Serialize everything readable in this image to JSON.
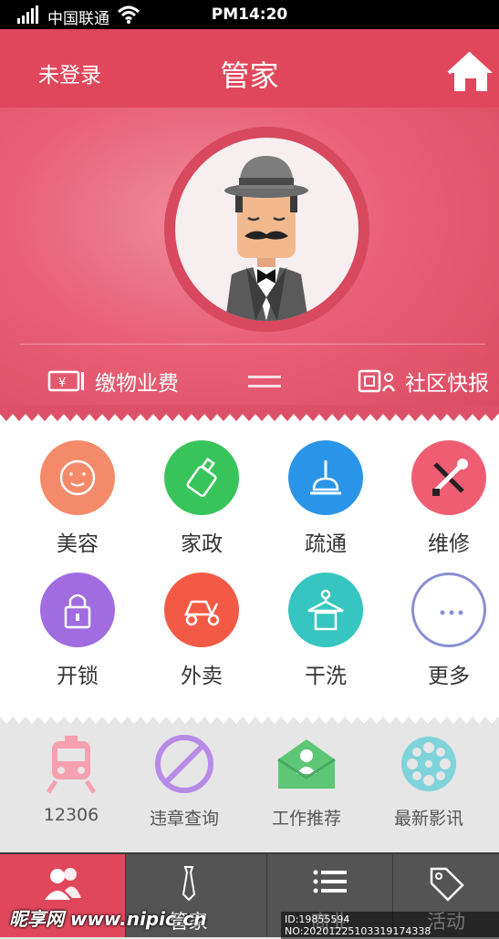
{
  "status": {
    "carrier": "中国联通",
    "time": "PM14:20"
  },
  "header": {
    "login": "未登录",
    "title": "管家"
  },
  "hero": {
    "pay_label": "缴物业费",
    "news_label": "社区快报"
  },
  "services": [
    {
      "label": "美容",
      "color": "#f48a6a",
      "icon": "face-icon"
    },
    {
      "label": "家政",
      "color": "#38c45a",
      "icon": "spray-bottle-icon"
    },
    {
      "label": "疏通",
      "color": "#2a95e8",
      "icon": "plunger-icon"
    },
    {
      "label": "维修",
      "color": "#ef5d72",
      "icon": "tools-icon"
    },
    {
      "label": "开锁",
      "color": "#a06ce0",
      "icon": "lock-icon"
    },
    {
      "label": "外卖",
      "color": "#f25a45",
      "icon": "scooter-icon"
    },
    {
      "label": "干洗",
      "color": "#36c5c0",
      "icon": "hanger-icon"
    },
    {
      "label": "更多",
      "color": "#8a8fd0",
      "icon": "more-icon"
    }
  ],
  "shortcuts": [
    {
      "label": "12306",
      "icon": "train-icon"
    },
    {
      "label": "违章查询",
      "icon": "prohibited-icon"
    },
    {
      "label": "工作推荐",
      "icon": "job-envelope-icon"
    },
    {
      "label": "最新影讯",
      "icon": "film-reel-icon"
    }
  ],
  "tabs": [
    {
      "label": "",
      "icon": "users-icon"
    },
    {
      "label": "管家",
      "icon": "tie-icon"
    },
    {
      "label": "商业",
      "icon": "list-icon"
    },
    {
      "label": "活动",
      "icon": "tag-icon"
    }
  ],
  "watermark": {
    "site": "昵享网 www.nipic.cn",
    "id": "ID:19855594 NO:20201225103319174338"
  }
}
